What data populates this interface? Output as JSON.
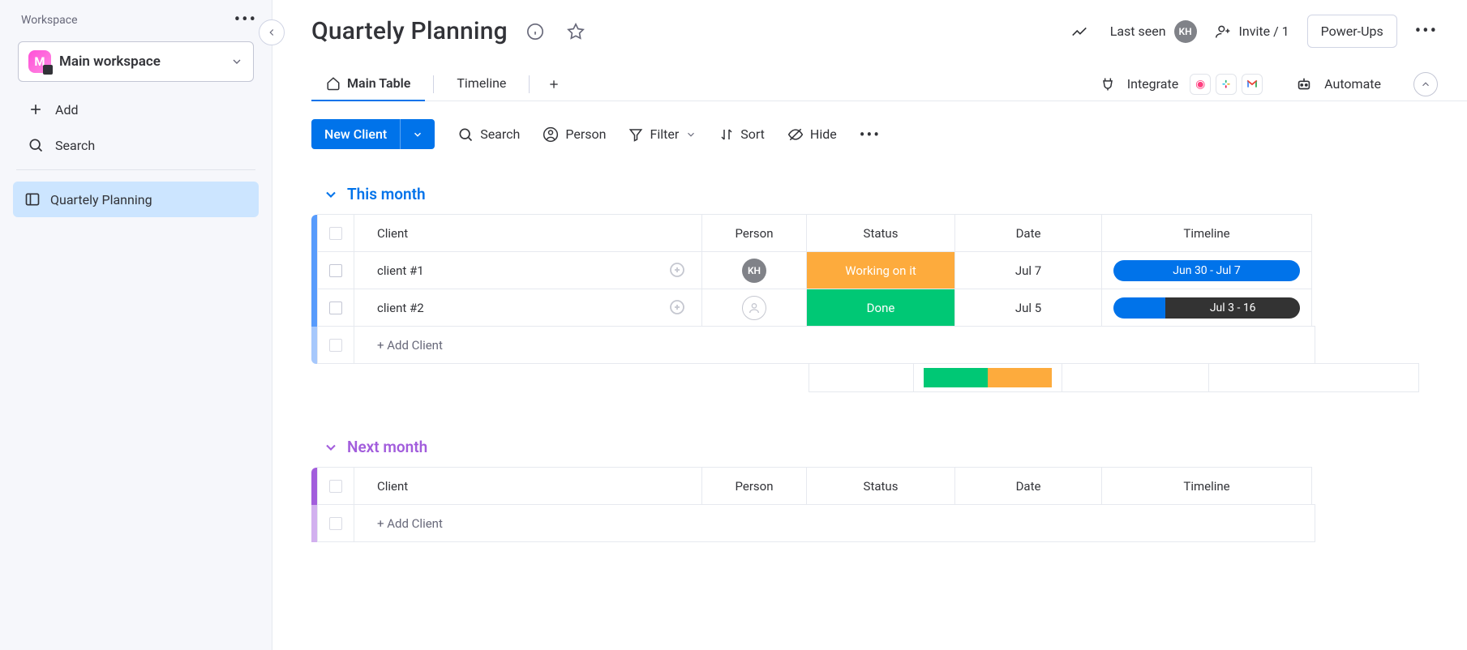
{
  "sidebar": {
    "heading": "Workspace",
    "workspaceBadge": "M",
    "workspaceName": "Main workspace",
    "add": "Add",
    "search": "Search",
    "board": "Quartely Planning"
  },
  "header": {
    "title": "Quartely Planning",
    "lastSeen": "Last seen",
    "avatar": "KH",
    "invite": "Invite / 1",
    "powerUps": "Power-Ups"
  },
  "tabs": {
    "main": "Main Table",
    "timeline": "Timeline",
    "integrate": "Integrate",
    "automate": "Automate"
  },
  "toolbar": {
    "newClient": "New Client",
    "search": "Search",
    "person": "Person",
    "filter": "Filter",
    "sort": "Sort",
    "hide": "Hide"
  },
  "columns": {
    "client": "Client",
    "person": "Person",
    "status": "Status",
    "date": "Date",
    "timeline": "Timeline"
  },
  "groups": [
    {
      "name": "This month",
      "rows": [
        {
          "client": "client #1",
          "personInitials": "KH",
          "status": "Working on it",
          "statusClass": "st-work",
          "date": "Jul 7",
          "timeline": "Jun 30 - Jul 7",
          "tlType": 1
        },
        {
          "client": "client #2",
          "personInitials": "",
          "status": "Done",
          "statusClass": "st-done",
          "date": "Jul 5",
          "timeline": "Jul 3 - 16",
          "tlType": 2
        }
      ],
      "addLabel": "+ Add Client"
    },
    {
      "name": "Next month",
      "rows": [],
      "addLabel": "+ Add Client"
    }
  ]
}
